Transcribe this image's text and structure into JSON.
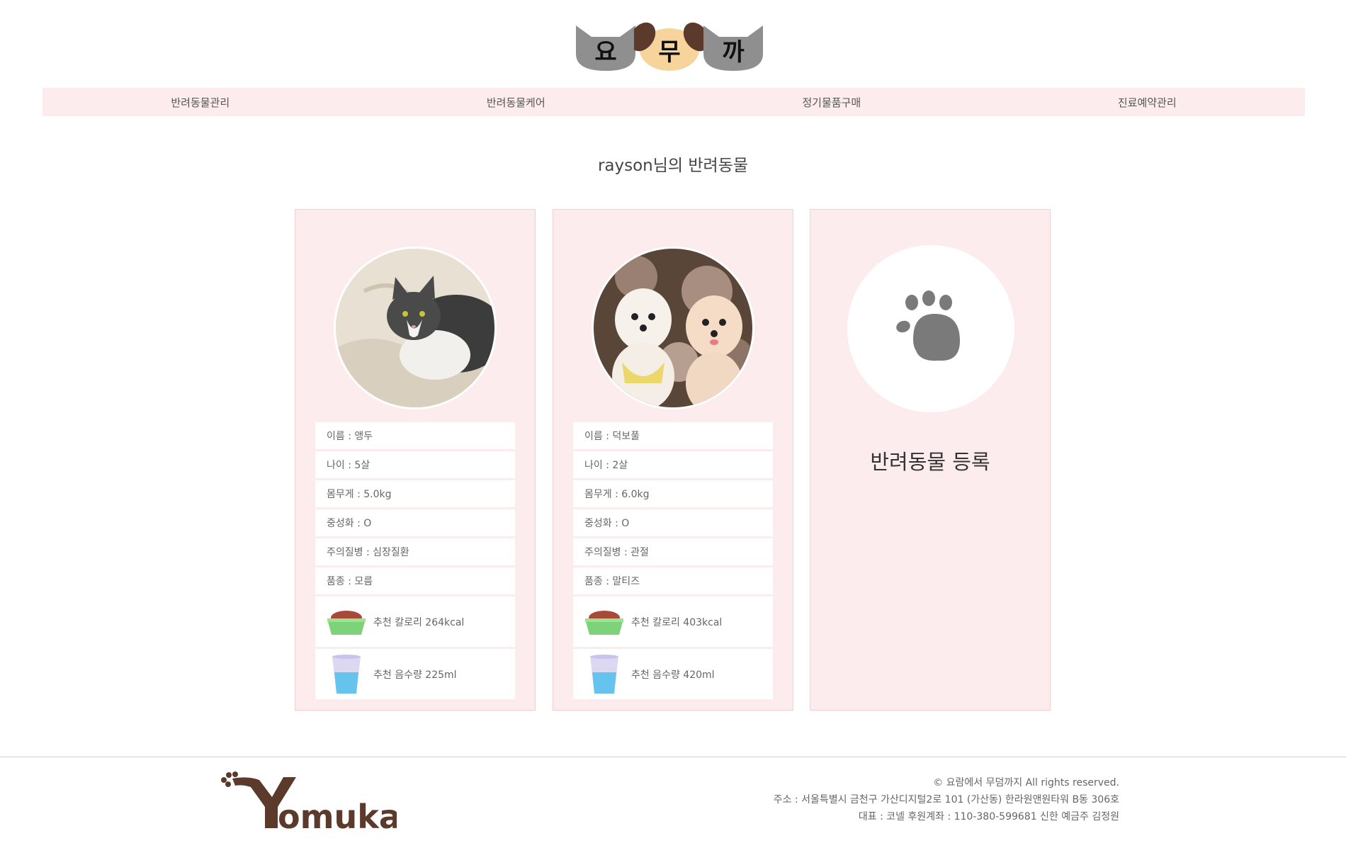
{
  "logo": {
    "chars": [
      "요",
      "무",
      "까"
    ]
  },
  "nav": {
    "items": [
      "반려동물관리",
      "반려동물케어",
      "정기물품구매",
      "진료예약관리"
    ]
  },
  "page_title": "rayson님의 반려동물",
  "pets": [
    {
      "name": "이름 : 앵두",
      "age": "나이 : 5살",
      "weight": "몸무게 : 5.0kg",
      "neutered": "중성화 : O",
      "disease": "주의질병 : 심장질환",
      "breed": "품종 : 모름",
      "calorie": "추천 칼로리 264kcal",
      "water": "추천 음수량 225ml"
    },
    {
      "name": "이름 : 덕보풀",
      "age": "나이 : 2살",
      "weight": "몸무게 : 6.0kg",
      "neutered": "중성화 : O",
      "disease": "주의질병 : 관절",
      "breed": "품종 : 말티즈",
      "calorie": "추천 칼로리 403kcal",
      "water": "추천 음수량 420ml"
    }
  ],
  "add_card": {
    "label": "반려동물 등록"
  },
  "footer": {
    "copyright": "© 요람에서 무덤까지 All rights reserved.",
    "address": "주소 : 서울특별시 금천구 가산디지털2로 101 (가산동) 한라원앤원타워 B동 306호",
    "ceo": "대표 : 코넬 후원계좌 : 110-380-599681 신한 예금주 김정원"
  },
  "colors": {
    "nav_bg": "#fdeced",
    "card_bg": "#fdeced",
    "logo_brown": "#5b3a2c",
    "logo_gray": "#8f8f8f"
  },
  "icons": [
    "cat-head-icon",
    "dog-head-icon",
    "paw-icon",
    "food-bowl-icon",
    "water-cup-icon"
  ]
}
